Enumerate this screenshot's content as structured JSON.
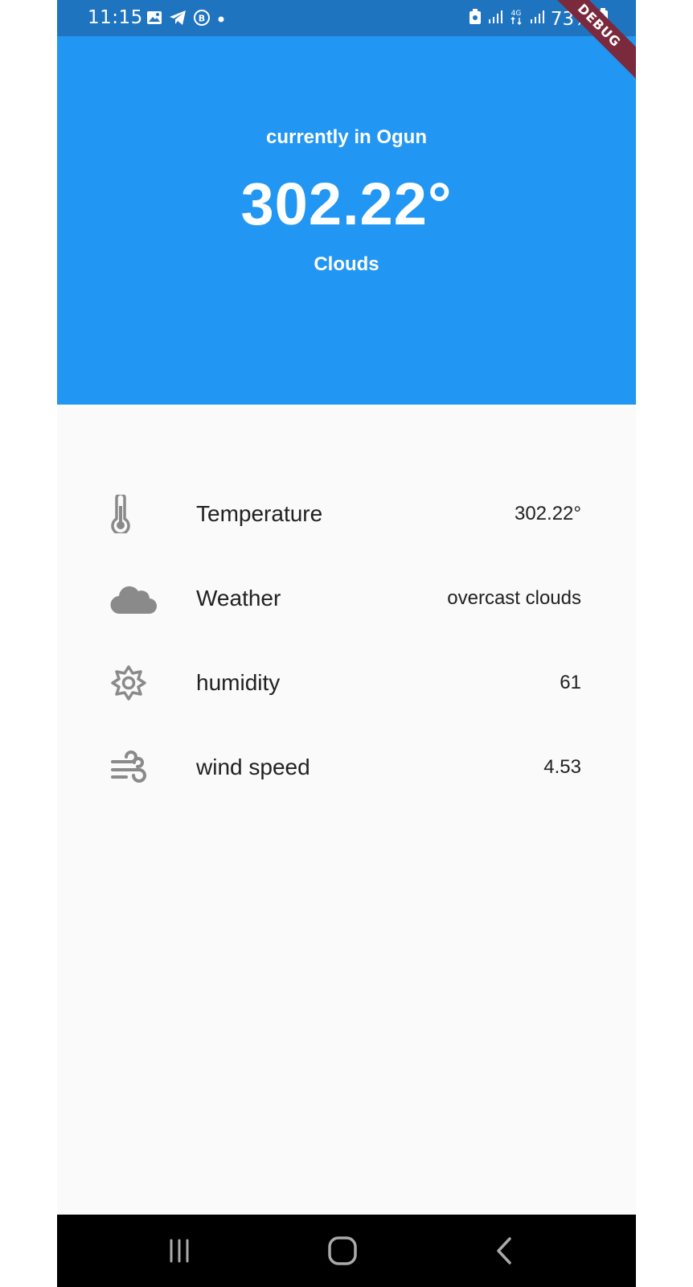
{
  "status_bar": {
    "time": "11:15",
    "battery": "73%",
    "network": "4G"
  },
  "debug_banner": "DEBUG",
  "header": {
    "location": "currently in Ogun",
    "temperature": "302.22°",
    "condition": "Clouds"
  },
  "details": [
    {
      "icon": "thermometer-icon",
      "label": "Temperature",
      "value": "302.22°"
    },
    {
      "icon": "cloud-icon",
      "label": "Weather",
      "value": "overcast clouds"
    },
    {
      "icon": "gear-icon",
      "label": "humidity",
      "value": "61"
    },
    {
      "icon": "wind-icon",
      "label": "wind speed",
      "value": "4.53"
    }
  ],
  "colors": {
    "status_bar": "#1f74c0",
    "header": "#2196f3",
    "body": "#fafafa",
    "icon": "#8a8a8a",
    "ribbon": "#7a2a3c"
  }
}
